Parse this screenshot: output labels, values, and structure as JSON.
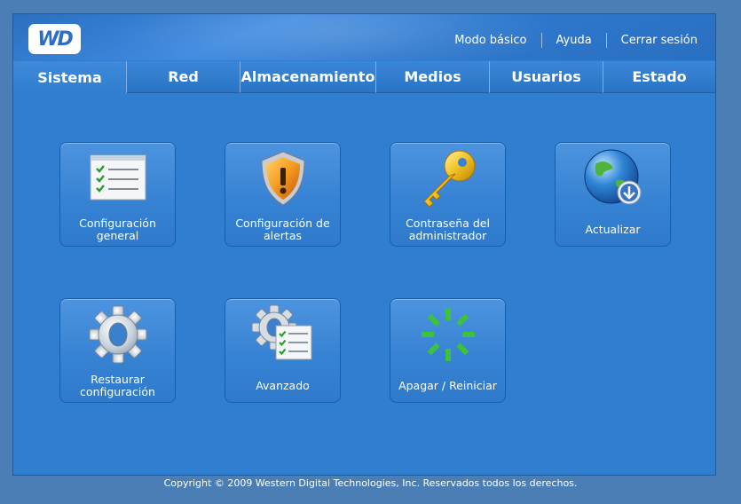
{
  "header": {
    "logo_text": "WD",
    "links": [
      "Modo básico",
      "Ayuda",
      "Cerrar sesión"
    ]
  },
  "tabs": [
    "Sistema",
    "Red",
    "Almacenamiento",
    "Medios",
    "Usuarios",
    "Estado"
  ],
  "active_tab": "Sistema",
  "tiles": [
    {
      "label": "Configuración general",
      "icon": "checklist-icon"
    },
    {
      "label": "Configuración de alertas",
      "icon": "warning-shield-icon"
    },
    {
      "label": "Contraseña del administrador",
      "icon": "key-icon"
    },
    {
      "label": "Actualizar",
      "icon": "globe-download-icon"
    },
    {
      "label": "Restaurar configuración",
      "icon": "gear-icon"
    },
    {
      "label": "Avanzado",
      "icon": "gear-checklist-icon"
    },
    {
      "label": "Apagar / Reiniciar",
      "icon": "restart-spinner-icon"
    }
  ],
  "footer": "Copyright © 2009 Western Digital Technologies, Inc. Reservados todos los derechos.",
  "colors": {
    "background": "#4a7eb4",
    "panel": "#2f7ed0",
    "accent_green": "#3bc43b",
    "key_gold": "#f0c020"
  }
}
